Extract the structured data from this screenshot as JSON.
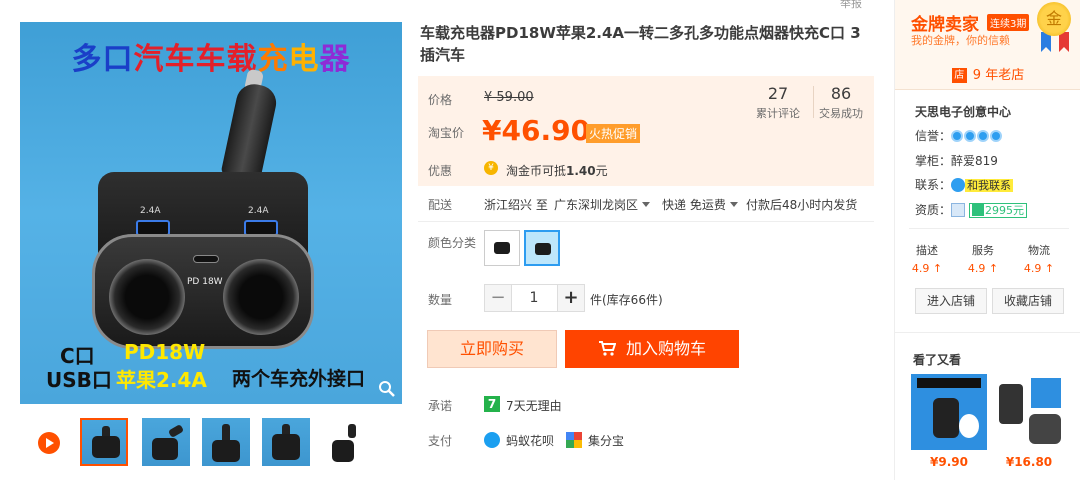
{
  "gallery": {
    "main_title": [
      "多口",
      "汽",
      "车",
      "车载",
      "充",
      "电",
      "器"
    ],
    "caption_c": "C口",
    "caption_usb": "USB口",
    "caption_pd": "PD18W",
    "caption_apple": "苹果2.4A",
    "caption_ext": "两个车充外接口",
    "usb_label_left": "2.4A",
    "usb_label_right": "2.4A",
    "pd_label": "PD 18W"
  },
  "product": {
    "report": "举报",
    "title": "车载充电器PD18W苹果2.4A一转二多孔多功能点烟器快充C口 3插汽车",
    "price_label": "价格",
    "original_price": "¥ 59.00",
    "taobao_price_label": "淘宝价",
    "current_price": "¥46.90",
    "promo_badge": "火热促销",
    "reviews_count": "27",
    "reviews_label": "累计评论",
    "sales_count": "86",
    "sales_label": "交易成功",
    "discount_label": "优惠",
    "coin_prefix": "淘金币可抵",
    "coin_amount": "1.40",
    "coin_suffix": "元",
    "shipping_label": "配送",
    "ship_from": "浙江绍兴 至",
    "ship_to": "广东深圳龙岗区",
    "ship_method": "快递 免运费",
    "ship_time": "付款后48小时内发货",
    "color_label": "颜色分类",
    "quantity_label": "数量",
    "quantity": "1",
    "stock": "件(库存66件)",
    "buy_now": "立即购买",
    "add_to_cart": "加入购物车",
    "promise_label": "承诺",
    "promise_text": "7天无理由",
    "promise_icon": "7",
    "payment_label": "支付",
    "pay_huabei": "蚂蚁花呗",
    "pay_jifenbao": "集分宝"
  },
  "shop": {
    "gold_title": "金牌卖家",
    "streak": "连续3期",
    "gold_sub": "我的金牌，你的信赖",
    "medal": "金",
    "years": "9 年老店",
    "dian": "店",
    "name": "天思电子创意中心",
    "credit_label": "信誉：",
    "keeper_label": "掌柜：",
    "keeper": "醉爱819",
    "contact_label": "联系：",
    "contact_button": "和我联系",
    "qual_label": "资质：",
    "deposit": "2995元",
    "ratings": [
      {
        "label": "描述",
        "value": "4.9 ↑"
      },
      {
        "label": "服务",
        "value": "4.9 ↑"
      },
      {
        "label": "物流",
        "value": "4.9 ↑"
      }
    ],
    "enter_shop": "进入店铺",
    "fav_shop": "收藏店铺",
    "also_viewed": "看了又看",
    "also_items": [
      {
        "price": "¥9.90"
      },
      {
        "price": "¥16.80"
      }
    ]
  },
  "colors": {
    "accent": "#ff5000",
    "cart": "#ff4400",
    "price_bg": "#fff2e8"
  }
}
